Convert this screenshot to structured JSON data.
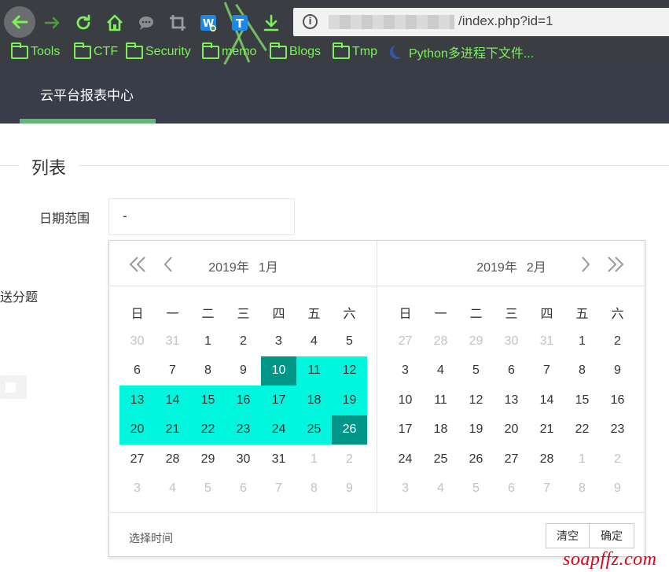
{
  "browser": {
    "url_path": "/index.php?id=1",
    "url_info_glyph": "i",
    "toolbar_icons": [
      "back-arrow-icon",
      "forward-arrow-icon",
      "reload-icon",
      "home-icon",
      "chat-bubble-icon",
      "crop-icon",
      "translate-w-icon",
      "translate-t-icon",
      "download-icon"
    ],
    "bookmarks": [
      {
        "label": "Tools",
        "icon": "folder-icon"
      },
      {
        "label": "CTF",
        "icon": "folder-icon"
      },
      {
        "label": "Security",
        "icon": "folder-icon"
      },
      {
        "label": "memo",
        "icon": "folder-icon"
      },
      {
        "label": "Blogs",
        "icon": "folder-icon"
      },
      {
        "label": "Tmp",
        "icon": "folder-icon"
      },
      {
        "label": "Python多进程下文件...",
        "icon": "moon-icon"
      }
    ],
    "w_badge": "W",
    "t_badge": "T"
  },
  "header": {
    "title": "云平台报表中心",
    "bg_color": "#393d49",
    "accent_color": "#5fb878"
  },
  "main": {
    "section_title": "列表",
    "date_range_label": "日期范围",
    "date_input_value": "-",
    "bg_label": "送分题"
  },
  "datepicker": {
    "weekdays": [
      "日",
      "一",
      "二",
      "三",
      "四",
      "五",
      "六"
    ],
    "left": {
      "year_label": "2019年",
      "month_label": "1月",
      "weeks": [
        [
          {
            "d": "30",
            "t": "other"
          },
          {
            "d": "31",
            "t": "other"
          },
          {
            "d": "1"
          },
          {
            "d": "2"
          },
          {
            "d": "3"
          },
          {
            "d": "4"
          },
          {
            "d": "5"
          }
        ],
        [
          {
            "d": "6"
          },
          {
            "d": "7"
          },
          {
            "d": "8"
          },
          {
            "d": "9"
          },
          {
            "d": "10",
            "t": "sel"
          },
          {
            "d": "11",
            "t": "range"
          },
          {
            "d": "12",
            "t": "range"
          }
        ],
        [
          {
            "d": "13",
            "t": "range"
          },
          {
            "d": "14",
            "t": "range"
          },
          {
            "d": "15",
            "t": "range"
          },
          {
            "d": "16",
            "t": "range"
          },
          {
            "d": "17",
            "t": "range"
          },
          {
            "d": "18",
            "t": "range"
          },
          {
            "d": "19",
            "t": "range"
          }
        ],
        [
          {
            "d": "20",
            "t": "range"
          },
          {
            "d": "21",
            "t": "range"
          },
          {
            "d": "22",
            "t": "range"
          },
          {
            "d": "23",
            "t": "range"
          },
          {
            "d": "24",
            "t": "range"
          },
          {
            "d": "25",
            "t": "range"
          },
          {
            "d": "26",
            "t": "sel"
          }
        ],
        [
          {
            "d": "27"
          },
          {
            "d": "28"
          },
          {
            "d": "29"
          },
          {
            "d": "30"
          },
          {
            "d": "31"
          },
          {
            "d": "1",
            "t": "other"
          },
          {
            "d": "2",
            "t": "other"
          }
        ],
        [
          {
            "d": "3",
            "t": "other"
          },
          {
            "d": "4",
            "t": "other"
          },
          {
            "d": "5",
            "t": "other"
          },
          {
            "d": "6",
            "t": "other"
          },
          {
            "d": "7",
            "t": "other"
          },
          {
            "d": "8",
            "t": "other"
          },
          {
            "d": "9",
            "t": "other"
          }
        ]
      ]
    },
    "right": {
      "year_label": "2019年",
      "month_label": "2月",
      "weeks": [
        [
          {
            "d": "27",
            "t": "other"
          },
          {
            "d": "28",
            "t": "other"
          },
          {
            "d": "29",
            "t": "other"
          },
          {
            "d": "30",
            "t": "other"
          },
          {
            "d": "31",
            "t": "other"
          },
          {
            "d": "1"
          },
          {
            "d": "2"
          }
        ],
        [
          {
            "d": "3"
          },
          {
            "d": "4"
          },
          {
            "d": "5"
          },
          {
            "d": "6"
          },
          {
            "d": "7"
          },
          {
            "d": "8"
          },
          {
            "d": "9"
          }
        ],
        [
          {
            "d": "10"
          },
          {
            "d": "11"
          },
          {
            "d": "12"
          },
          {
            "d": "13"
          },
          {
            "d": "14"
          },
          {
            "d": "15"
          },
          {
            "d": "16"
          }
        ],
        [
          {
            "d": "17"
          },
          {
            "d": "18"
          },
          {
            "d": "19"
          },
          {
            "d": "20"
          },
          {
            "d": "21"
          },
          {
            "d": "22"
          },
          {
            "d": "23"
          }
        ],
        [
          {
            "d": "24"
          },
          {
            "d": "25"
          },
          {
            "d": "26"
          },
          {
            "d": "27"
          },
          {
            "d": "28"
          },
          {
            "d": "1",
            "t": "other"
          },
          {
            "d": "2",
            "t": "other"
          }
        ],
        [
          {
            "d": "3",
            "t": "other"
          },
          {
            "d": "4",
            "t": "other"
          },
          {
            "d": "5",
            "t": "other"
          },
          {
            "d": "6",
            "t": "other"
          },
          {
            "d": "7",
            "t": "other"
          },
          {
            "d": "8",
            "t": "other"
          },
          {
            "d": "9",
            "t": "other"
          }
        ]
      ]
    },
    "footer": {
      "select_time": "选择时间",
      "clear": "清空",
      "confirm": "确定"
    },
    "colors": {
      "selected": "#009688",
      "range": "#00f7de",
      "muted_text": "#c2c2c2"
    }
  },
  "watermark": "soapffz.com"
}
